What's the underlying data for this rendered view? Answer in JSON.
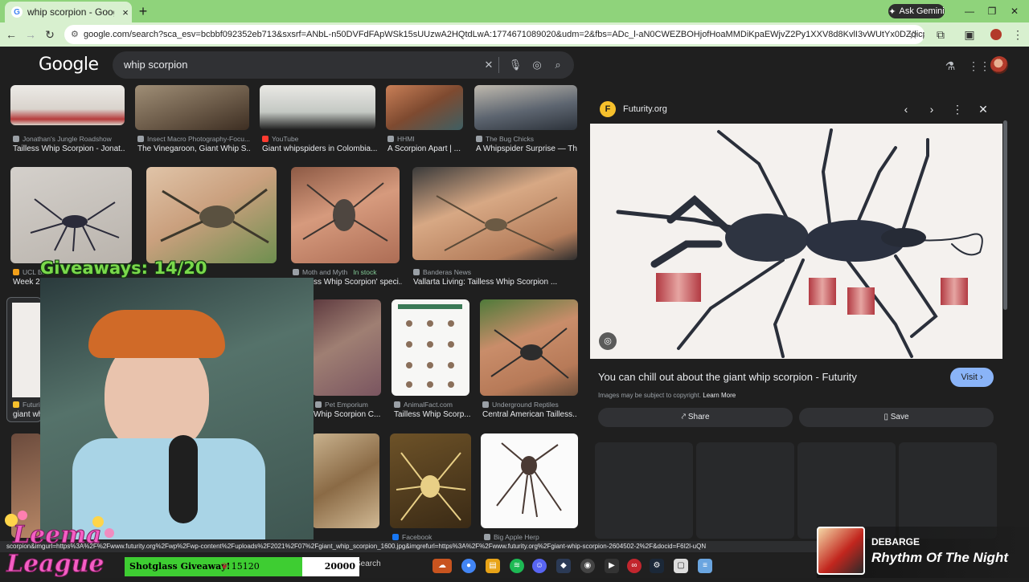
{
  "browser": {
    "tab_title": "whip scorpion - Google Search",
    "tab_close": "×",
    "new_tab": "+",
    "ask_gemini": "Ask Gemini",
    "url": "google.com/search?sca_esv=bcbbf092352eb713&sxsrf=ANbL-n50DVFdFApWSk15sUUzwA2HQtdLwA:1774671089020&udm=2&fbs=ADc_l-aN0CWEZBOHjofHoaMMDiKpaEWjvZ2Py1XXV8d8KvlI3vWUtYx0DZdicpfE1faGYemg2KC4yuMPyQlIvlWqq2..."
  },
  "google": {
    "logo": "Google",
    "query": "whip scorpion"
  },
  "results": {
    "row1": [
      {
        "source": "Jonathan's Jungle Roadshow",
        "caption": "Tailless Whip Scorpion - Jonat..."
      },
      {
        "source": "Insect Macro Photography-Focu...",
        "caption": "The Vinegaroon, Giant Whip S..."
      },
      {
        "source": "YouTube",
        "caption": "Giant whipspiders in Colombia..."
      },
      {
        "source": "HHMI",
        "caption": "A Scorpion Apart | ..."
      },
      {
        "source": "The Bug Chicks",
        "caption": "A Whipspider Surprise — Th..."
      }
    ],
    "row2": [
      {
        "source": "UCL Bl...",
        "caption": "Week 25"
      },
      {
        "source": "Moth and Myth",
        "extra": "In stock",
        "caption": "ss Whip Scorpion' speci..."
      },
      {
        "source": "Banderas News",
        "caption": "Vallarta Living: Tailless Whip Scorpion ..."
      }
    ],
    "row3": [
      {
        "source": "Futurit...",
        "caption": "giant wh..."
      },
      {
        "source": "Pet Emporium",
        "caption": "Whip Scorpion C..."
      },
      {
        "source": "AnimalFact.com",
        "caption": "Tailless Whip Scorp..."
      },
      {
        "source": "Underground Reptiles",
        "caption": "Central American Tailless..."
      }
    ],
    "row4": [
      {
        "source": "Facebook"
      },
      {
        "source": "Big Apple Herp"
      }
    ]
  },
  "panel": {
    "site": "Futurity.org",
    "site_initial": "F",
    "title": "You can chill out about the giant whip scorpion - Futurity",
    "visit": "Visit",
    "copyright": "Images may be subject to copyright.",
    "learn_more": "Learn More",
    "share": "Share",
    "save": "Save"
  },
  "status_url": "scorpion&imgurl=https%3A%2F%2Fwww.futurity.org%2Fwp%2Fwp-content%2Fuploads%2F2021%2F07%2Fgiant_whip_scorpion_1600.jpg&imgrefurl=https%3A%2F%2Fwww.futurity.org%2Fgiant-whip-scorpion-2604502-2%2F&docid=F6I2l-uQN",
  "taskbar": {
    "search": "Search"
  },
  "stream": {
    "giveaways": "Giveaways: 14/20",
    "shotglass_label": "Shotglass Giveaway!",
    "shotglass_current": "15120",
    "shotglass_goal": "20000",
    "shotglass_progress": 0.756,
    "brand_line1": "Leema",
    "brand_line2": "League",
    "now_playing_artist": "DEBARGE",
    "now_playing_title": "Rhythm Of The Night"
  },
  "colors": {
    "chrome_tab_bar": "#8fd37b",
    "google_bg": "#1f1f1f",
    "visit_button": "#8ab4f8",
    "giveaway_green": "#7ad84b",
    "shotglass_bar": "#3ecd32"
  }
}
